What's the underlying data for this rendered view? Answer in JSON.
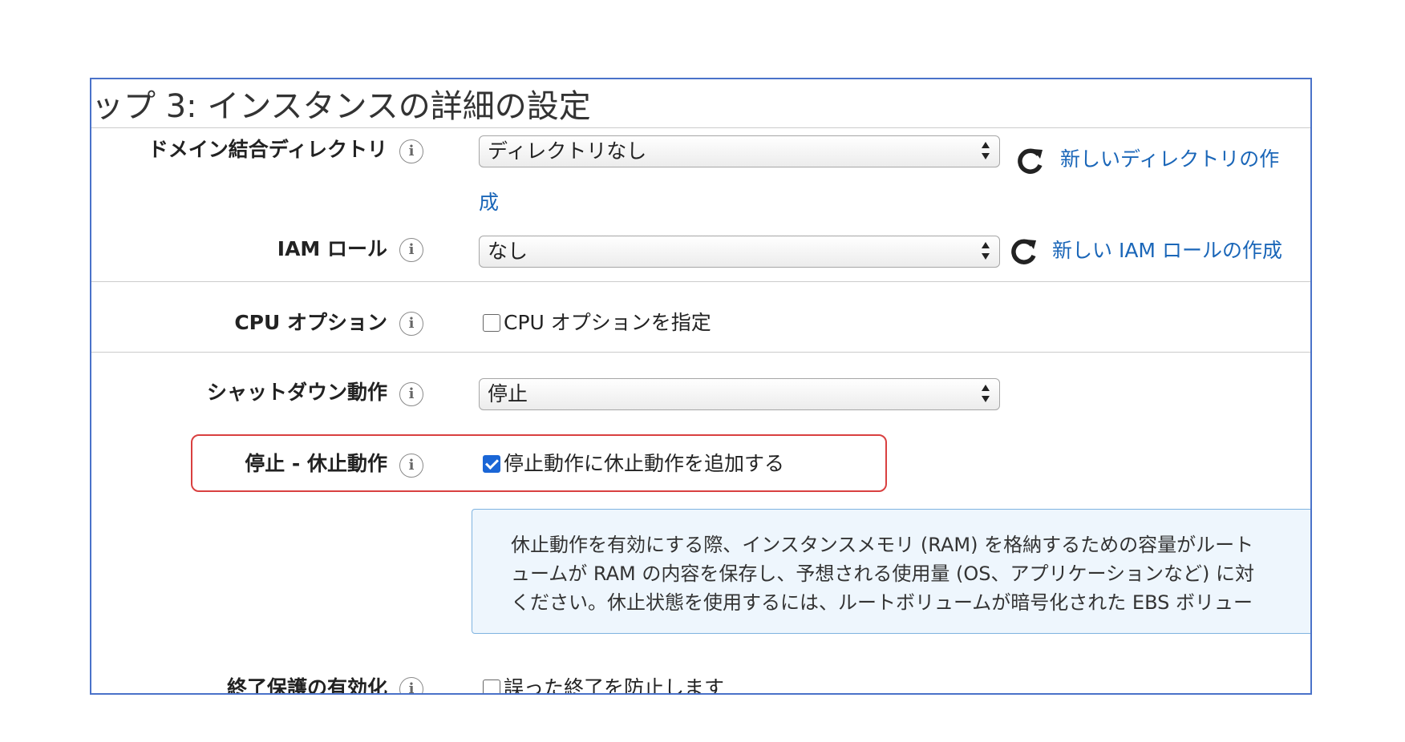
{
  "page": {
    "title": "ップ 3: インスタンスの詳細の設定"
  },
  "domain_join": {
    "label": "ドメイン結合ディレクトリ",
    "selected": "ディレクトリなし",
    "link_line1": "新しいディレクトリの作",
    "link_line2": "成"
  },
  "iam_role": {
    "label": "IAM ロール",
    "selected": "なし",
    "link": "新しい IAM ロールの作成"
  },
  "cpu_options": {
    "label": "CPU オプション",
    "checkbox_label": "CPU オプションを指定",
    "checked": false
  },
  "shutdown": {
    "label": "シャットダウン動作",
    "selected": "停止"
  },
  "hibernate": {
    "label": "停止 - 休止動作",
    "checkbox_label": "停止動作に休止動作を追加する",
    "checked": true
  },
  "hibernate_info": {
    "line1": "休止動作を有効にする際、インスタンスメモリ (RAM) を格納するための容量がルート",
    "line2": "ュームが RAM の内容を保存し、予想される使用量 (OS、アプリケーションなど) に対",
    "line3": "ください。休止状態を使用するには、ルートボリュームが暗号化された EBS ボリュー"
  },
  "termination": {
    "label": "終了保護の有効化",
    "checkbox_label": "誤った終了を防止します"
  },
  "icons": {
    "info": "info-icon",
    "refresh": "refresh-icon",
    "select_arrows": "select-arrows-icon"
  },
  "colors": {
    "link": "#1a66b8",
    "frame_border": "#4a72c9",
    "highlight_border": "#d94040",
    "infobox_bg": "#eef6fd",
    "checkbox_checked": "#1a66d6"
  }
}
